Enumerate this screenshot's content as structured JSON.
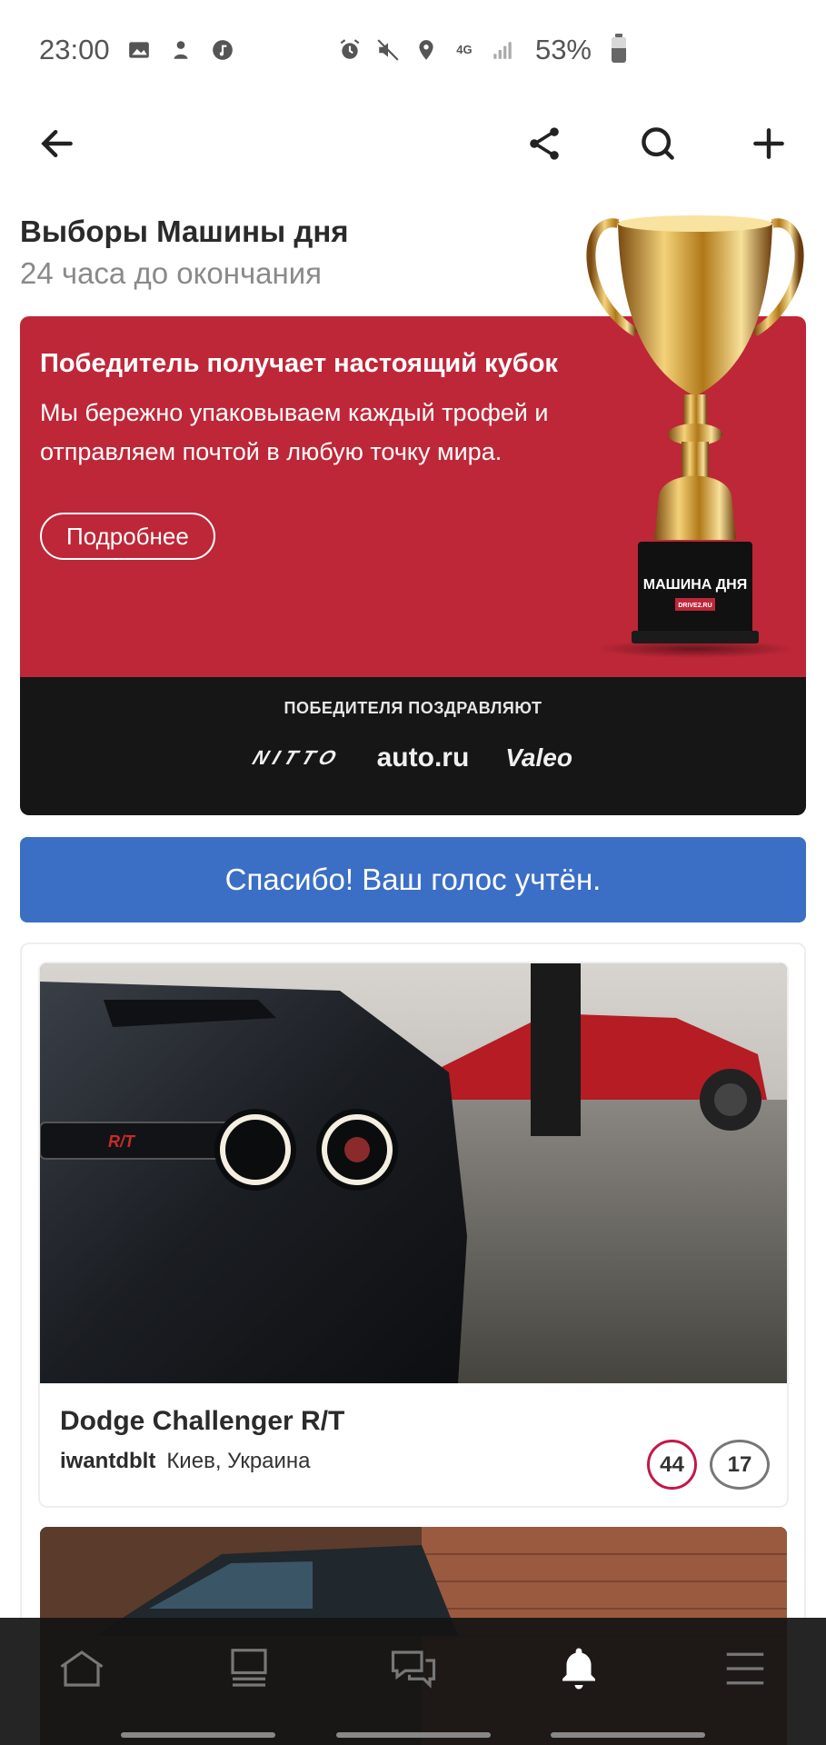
{
  "status_bar": {
    "time": "23:00",
    "battery_percent": "53%",
    "network": "4G"
  },
  "app_bar": {
    "back_icon": "arrow-left-icon",
    "share_icon": "share-icon",
    "search_icon": "search-icon",
    "add_icon": "plus-icon"
  },
  "heading": {
    "title": "Выборы Машины дня",
    "subtitle": "24 часа до окончания"
  },
  "promo": {
    "title": "Победитель получает настоящий кубок",
    "text": "Мы бережно упаковываем каждый трофей и отправляем почтой в любую точку мира.",
    "button_label": "Подробнее",
    "trophy_plate_title": "МАШИНА ДНЯ",
    "trophy_plate_sub": "DRIVE2.RU",
    "congrats_label": "ПОБЕДИТЕЛЯ ПОЗДРАВЛЯЮТ",
    "sponsors": [
      "NITTO",
      "auto.ru",
      "Valeo"
    ],
    "red_color": "#be2738"
  },
  "vote_banner": {
    "text": "Спасибо! Ваш голос учтён.",
    "color": "#3b6fc5"
  },
  "car_card": {
    "name": "Dodge Challenger R/T",
    "user": "iwantdblt",
    "location": "Киев, Украина",
    "votes": "44",
    "comments": "17",
    "grille_badge": "R/T"
  },
  "bottom_nav": {
    "items": [
      "home-icon",
      "feed-icon",
      "messages-icon",
      "notifications-icon",
      "menu-icon"
    ],
    "active": "notifications-icon"
  }
}
